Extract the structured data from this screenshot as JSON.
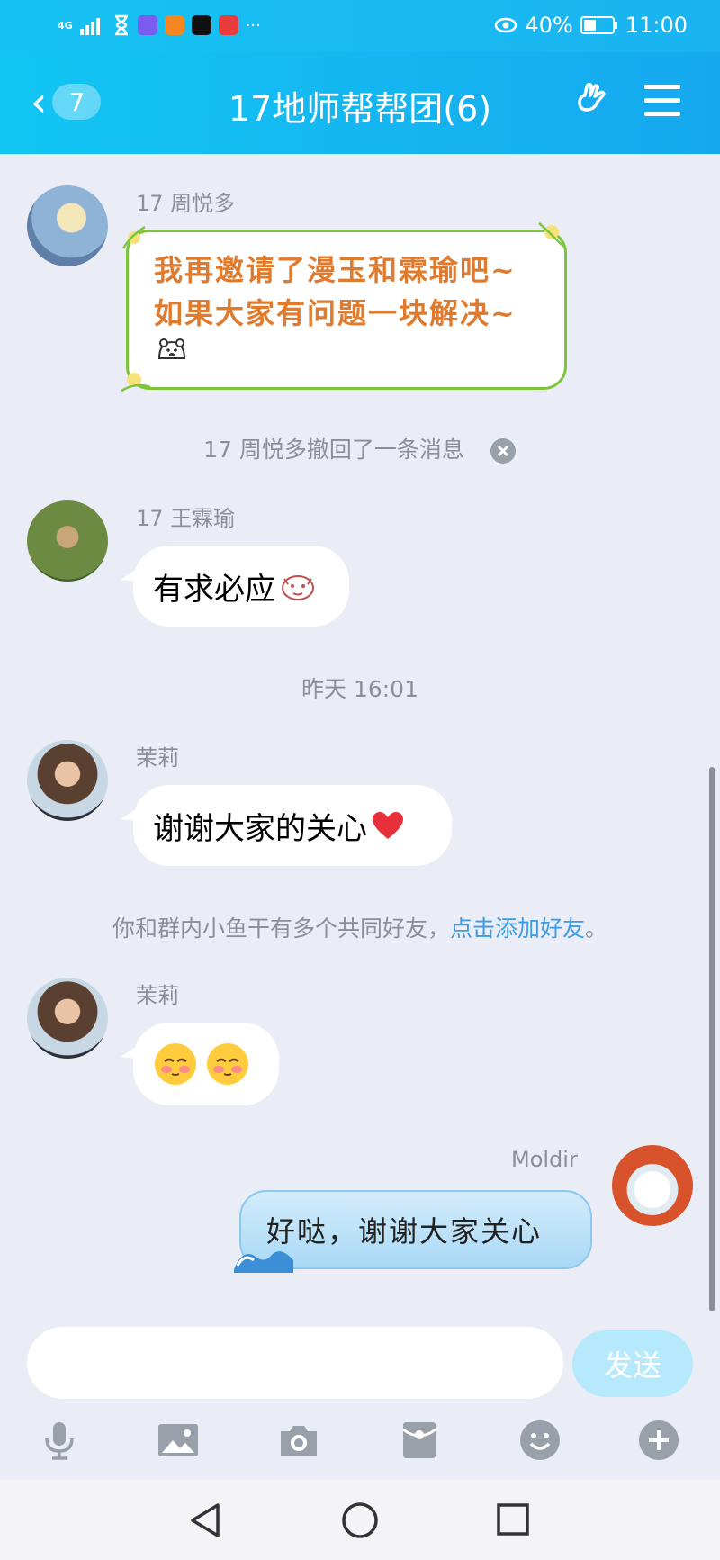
{
  "status_bar": {
    "network": "4G",
    "more": "···",
    "battery": "40%",
    "time": "11:00"
  },
  "header": {
    "back_count": "7",
    "title": "17地师帮帮团(6)"
  },
  "messages": [
    {
      "sender": "17 周悦多",
      "card_lines": [
        "我再邀请了漫玉和霖瑜吧~",
        "如果大家有问题一块解决~"
      ]
    },
    {
      "system": "17 周悦多撤回了一条消息"
    },
    {
      "sender": "17 王霖瑜",
      "text": "有求必应"
    },
    {
      "timestamp": "昨天 16:01"
    },
    {
      "sender": "茉莉",
      "text": "谢谢大家的关心"
    },
    {
      "system_prefix": "你和群内小鱼干有多个共同好友，",
      "system_link": "点击添加好友",
      "system_suffix": "。"
    },
    {
      "sender": "茉莉",
      "text": ""
    },
    {
      "sender": "Moldir",
      "text": "好哒，谢谢大家关心"
    }
  ],
  "composer": {
    "send_label": "发送"
  },
  "toolbar_icons": [
    "microphone-icon",
    "image-icon",
    "camera-icon",
    "red-packet-icon",
    "emoji-icon",
    "plus-icon"
  ],
  "colors": {
    "header": "#16b3f1",
    "link": "#3a9be6",
    "card_border": "#7cc53b",
    "card_text": "#e07a2d"
  }
}
